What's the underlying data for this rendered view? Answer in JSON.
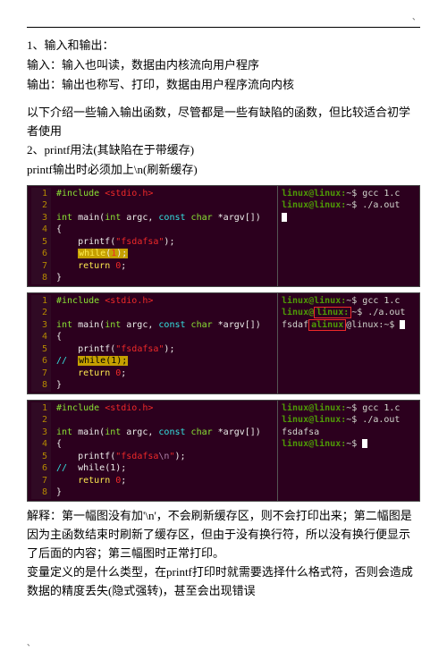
{
  "meta": {
    "dot": "、"
  },
  "intro": {
    "p1": "1、输入和输出：",
    "p2": "输入：输入也叫读，数据由内核流向用户程序",
    "p3": "输出：输出也称写、打印，数据由用户程序流向内核",
    "p4": "以下介绍一些输入输出函数，尽管都是一些有缺陷的函数，但比较适合初学者使用",
    "p5": "2、printf用法(其缺陷在于带缓存)",
    "p6": "printf输出时必须加上\\n(刷新缓存)"
  },
  "code1": {
    "l1a": "#include",
    "l1b": " <stdio.h>",
    "l3a": "int",
    "l3b": " main(",
    "l3c": "int",
    "l3d": " argc, ",
    "l3e": "const",
    "l3f": " ",
    "l3g": "char",
    "l3h": " *argv[])",
    "l4": "{",
    "l5a": "    printf(",
    "l5b": "\"fsdafsa\"",
    "l5c": ");",
    "l6a": "    ",
    "l6b": "while",
    "l6c": "(",
    "l6d": "1",
    "l6e": ");",
    "l7a": "    ",
    "l7b": "return",
    "l7c": " ",
    "l7d": "0",
    "l7e": ";",
    "l8": "}",
    "t1a": "linux@linux:",
    "t1b": "~$ gcc 1.c",
    "t2a": "linux@linux:",
    "t2b": "~$ ./a.out"
  },
  "code2": {
    "l1a": "#include",
    "l1b": " <stdio.h>",
    "l3a": "int",
    "l3b": " main(",
    "l3c": "int",
    "l3d": " argc, ",
    "l3e": "const",
    "l3f": " ",
    "l3g": "char",
    "l3h": " *argv[])",
    "l4": "{",
    "l5a": "    printf(",
    "l5b": "\"fsdafsa\"",
    "l5c": ");",
    "l6a": "//  ",
    "l6b": "while(1);",
    "l7a": "    ",
    "l7b": "return",
    "l7c": " ",
    "l7d": "0",
    "l7e": ";",
    "l8": "}",
    "t1a": "linux@linux:",
    "t1b": "~$ gcc 1.c",
    "t2a": "linux@",
    "t2boxed": "linux:",
    "t2b": "~$ ./a.out",
    "t3a": "fsdaf",
    "t3boxed": "alinux",
    "t3b": "@linux:~$ "
  },
  "code3": {
    "l1a": "#include",
    "l1b": " <stdio.h>",
    "l3a": "int",
    "l3b": " main(",
    "l3c": "int",
    "l3d": " argc, ",
    "l3e": "const",
    "l3f": " ",
    "l3g": "char",
    "l3h": " *argv[])",
    "l4": "{",
    "l5a": "    printf(",
    "l5b": "\"fsdafsa",
    "l5c": "\\n",
    "l5d": "\"",
    "l5e": ");",
    "l6a": "//  ",
    "l6b": "while(1);",
    "l7a": "    ",
    "l7b": "return",
    "l7c": " ",
    "l7d": "0",
    "l7e": ";",
    "l8": "}",
    "t1a": "linux@linux:",
    "t1b": "~$ gcc 1.c",
    "t2a": "linux@linux:",
    "t2b": "~$ ./a.out",
    "t3": "fsdafsa",
    "t4a": "linux@linux:",
    "t4b": "~$ "
  },
  "outro": {
    "p1": "解释：第一幅图没有加'\\n'，不会刷新缓存区，则不会打印出来；第二幅图是因为主函数结束时刷新了缓存区，但由于没有换行符，所以没有换行便显示了后面的内容；第三幅图时正常打印。",
    "p2": "变量定义的是什么类型，在printf打印时就需要选择什么格式符，否则会造成数据的精度丢失(隐式强转)，甚至会出现错误"
  },
  "footer": {
    "dot": "、"
  }
}
